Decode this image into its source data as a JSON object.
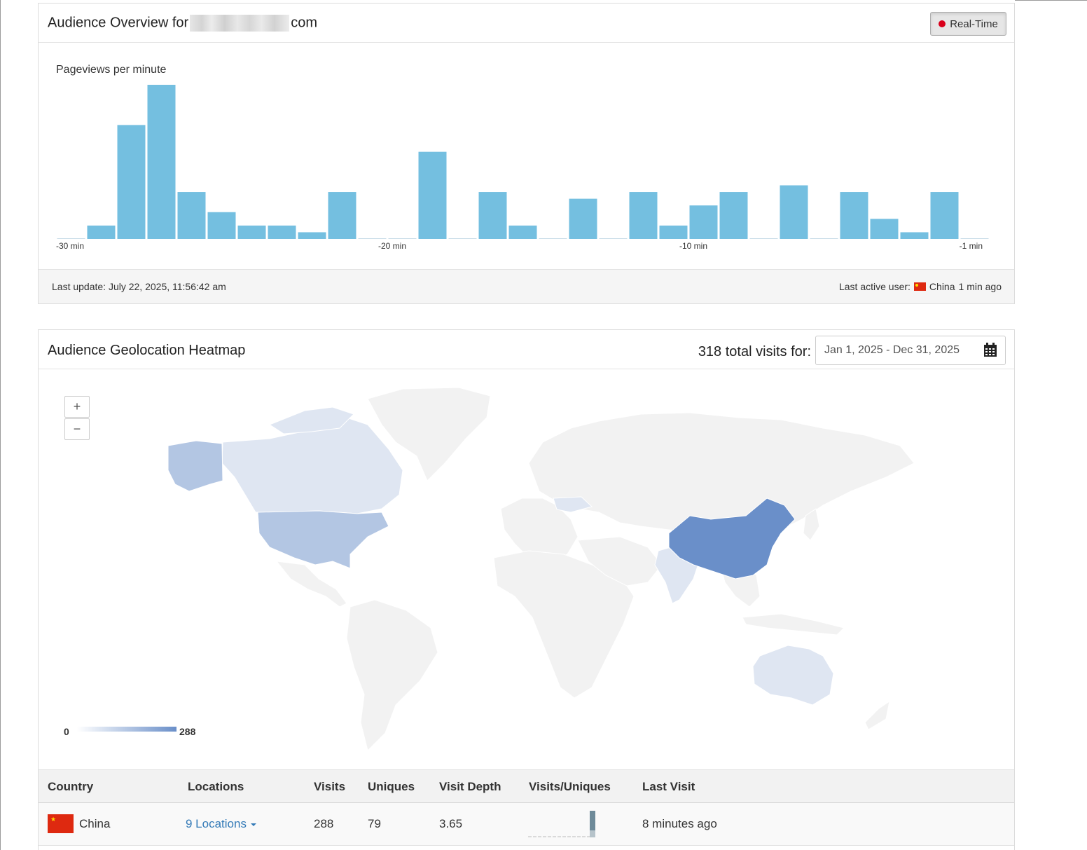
{
  "overview": {
    "title_prefix": "Audience Overview for",
    "title_suffix": "com",
    "realtime_label": "Real-Time",
    "chart_title": "Pageviews per minute",
    "last_update": "Last update: July 22, 2025, 11:56:42 am",
    "last_active_label": "Last active user:",
    "last_active_country": "China",
    "last_active_time": "1 min ago"
  },
  "chart_data": {
    "type": "bar",
    "title": "Pageviews per minute",
    "xlabel": "",
    "ylabel": "",
    "tick_labels": [
      "-30 min",
      "-20 min",
      "-10 min",
      "-1 min"
    ],
    "tick_indices": [
      0,
      10,
      20,
      30
    ],
    "ylim": [
      0,
      23
    ],
    "categories": [
      "-31",
      "-30",
      "-29",
      "-28",
      "-27",
      "-26",
      "-25",
      "-24",
      "-23",
      "-22",
      "-21",
      "-20",
      "-19",
      "-18",
      "-17",
      "-16",
      "-15",
      "-14",
      "-13",
      "-12",
      "-11",
      "-10",
      "-9",
      "-8",
      "-7",
      "-6",
      "-5",
      "-4",
      "-3",
      "-2",
      "-1"
    ],
    "values": [
      0,
      2,
      17,
      23,
      7,
      4,
      2,
      2,
      1,
      7,
      0,
      0,
      13,
      0,
      7,
      2,
      0,
      6,
      0,
      7,
      2,
      5,
      7,
      0,
      8,
      0,
      7,
      3,
      1,
      7,
      0
    ],
    "colors": {
      "bar": "#74bfe0",
      "baseline": "#c8dce8"
    }
  },
  "geo": {
    "title": "Audience Geolocation Heatmap",
    "total_visits": "318 total visits for:",
    "date_range": "Jan 1, 2025 - Dec 31, 2025",
    "zoom_in": "+",
    "zoom_out": "−",
    "legend_min": "0",
    "legend_max": "288",
    "colors": {
      "china": "#6a8fc9",
      "usa": "#b3c6e3",
      "light": "#dfe6f2",
      "base": "#f2f2f2"
    }
  },
  "table": {
    "headers": [
      "Country",
      "Locations",
      "Visits",
      "Uniques",
      "Visit Depth",
      "Visits/Uniques",
      "Last Visit"
    ],
    "rows": [
      {
        "country": "China",
        "locations": "9 Locations",
        "visits": "288",
        "uniques": "79",
        "visit_depth": "3.65",
        "last_visit": "8 minutes ago"
      }
    ]
  }
}
